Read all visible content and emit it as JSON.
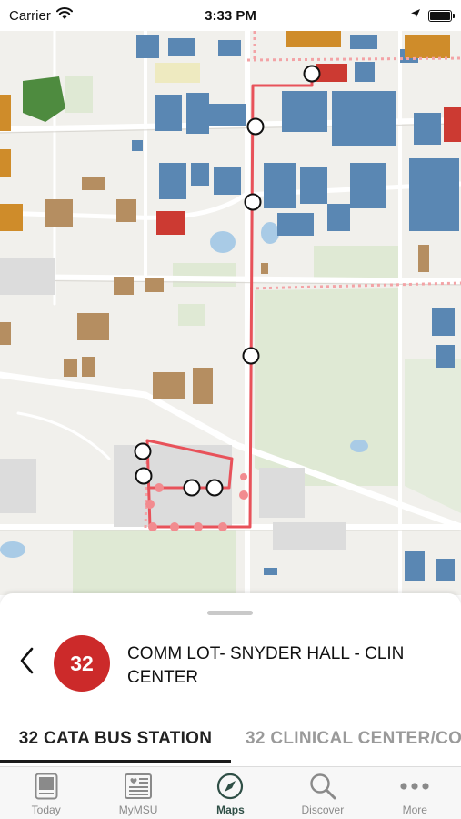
{
  "status_bar": {
    "carrier": "Carrier",
    "time": "3:33 PM",
    "battery_level": 1.0
  },
  "map": {
    "route_color": "#e8525a",
    "stop_count": 8
  },
  "route": {
    "number": "32",
    "title": "COMM LOT- SNYDER HALL - CLIN CENTER",
    "color": "#cc2a2a"
  },
  "direction_tabs": [
    {
      "label": "32 CATA BUS STATION",
      "selected": true
    },
    {
      "label": "32 CLINICAL CENTER/CO",
      "selected": false
    }
  ],
  "tab_bar": {
    "items": [
      {
        "label": "Today",
        "icon": "newspaper-icon",
        "selected": false
      },
      {
        "label": "MyMSU",
        "icon": "news-card-icon",
        "selected": false
      },
      {
        "label": "Maps",
        "icon": "compass-icon",
        "selected": true
      },
      {
        "label": "Discover",
        "icon": "search-icon",
        "selected": false
      },
      {
        "label": "More",
        "icon": "more-dots-icon",
        "selected": false
      }
    ],
    "active_color": "#2f4f46"
  }
}
